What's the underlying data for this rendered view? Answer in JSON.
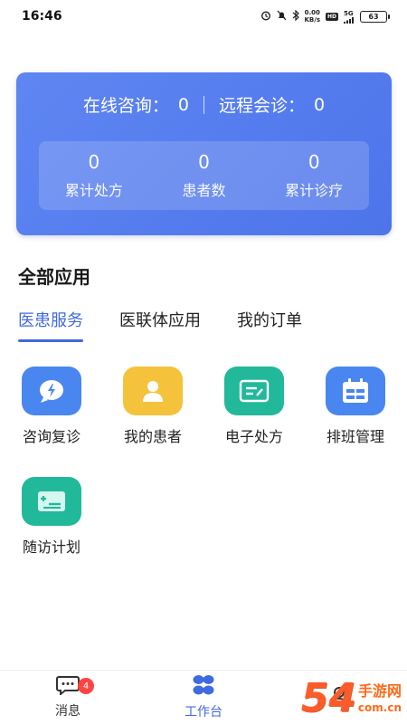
{
  "status_bar": {
    "time": "16:46",
    "net_speed_value": "0.00",
    "net_speed_unit": "KB/s",
    "hd_label": "HD",
    "signal_label": "5G",
    "battery": "63"
  },
  "summary": {
    "online_consult_label": "在线咨询：",
    "online_consult_value": "0",
    "remote_consult_label": "远程会诊：",
    "remote_consult_value": "0",
    "stats": [
      {
        "value": "0",
        "label": "累计处方"
      },
      {
        "value": "0",
        "label": "患者数"
      },
      {
        "value": "0",
        "label": "累计诊疗"
      }
    ]
  },
  "section_title": "全部应用",
  "tabs": [
    {
      "label": "医患服务"
    },
    {
      "label": "医联体应用"
    },
    {
      "label": "我的订单"
    }
  ],
  "apps": [
    {
      "label": "咨询复诊",
      "icon": "consult-chat-icon",
      "color": "#4a86f0"
    },
    {
      "label": "我的患者",
      "icon": "patient-person-icon",
      "color": "#f5c23c"
    },
    {
      "label": "电子处方",
      "icon": "prescription-icon",
      "color": "#22b89a"
    },
    {
      "label": "排班管理",
      "icon": "schedule-calendar-icon",
      "color": "#4a86f0"
    },
    {
      "label": "随访计划",
      "icon": "followup-plan-icon",
      "color": "#22b89a"
    }
  ],
  "bottom_nav": [
    {
      "label": "消息",
      "badge": "4"
    },
    {
      "label": "工作台"
    }
  ],
  "watermark": {
    "big": "54",
    "cn": "手游网",
    "url": "com.cn"
  }
}
